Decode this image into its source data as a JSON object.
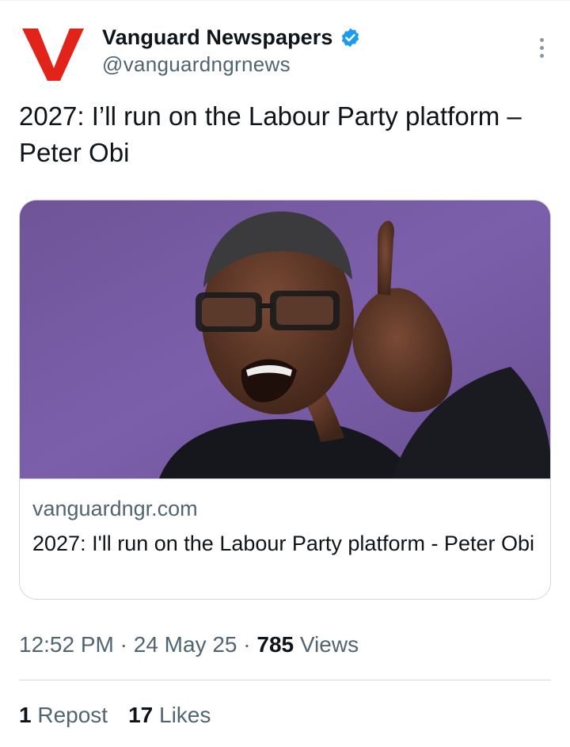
{
  "author": {
    "display_name": "Vanguard Newspapers",
    "handle": "@vanguardngrnews",
    "verified": true,
    "logo_letter": "V",
    "logo_color": "#e2231a",
    "verified_color": "#1d9bf0"
  },
  "tweet": {
    "text": "2027: I’ll run on the Labour Party platform – Peter Obi"
  },
  "link_card": {
    "domain": "vanguardngr.com",
    "title": "2027: I'll run on the Labour Party platform - Peter Obi"
  },
  "meta": {
    "time": "12:52 PM",
    "date": "24 May 25",
    "separator": "·",
    "views_count": "785",
    "views_label": "Views"
  },
  "engagement": {
    "reposts_count": "1",
    "reposts_label": "Repost",
    "likes_count": "17",
    "likes_label": "Likes"
  },
  "icons": {
    "more": "more-vertical-icon",
    "verified": "verified-badge-icon"
  }
}
